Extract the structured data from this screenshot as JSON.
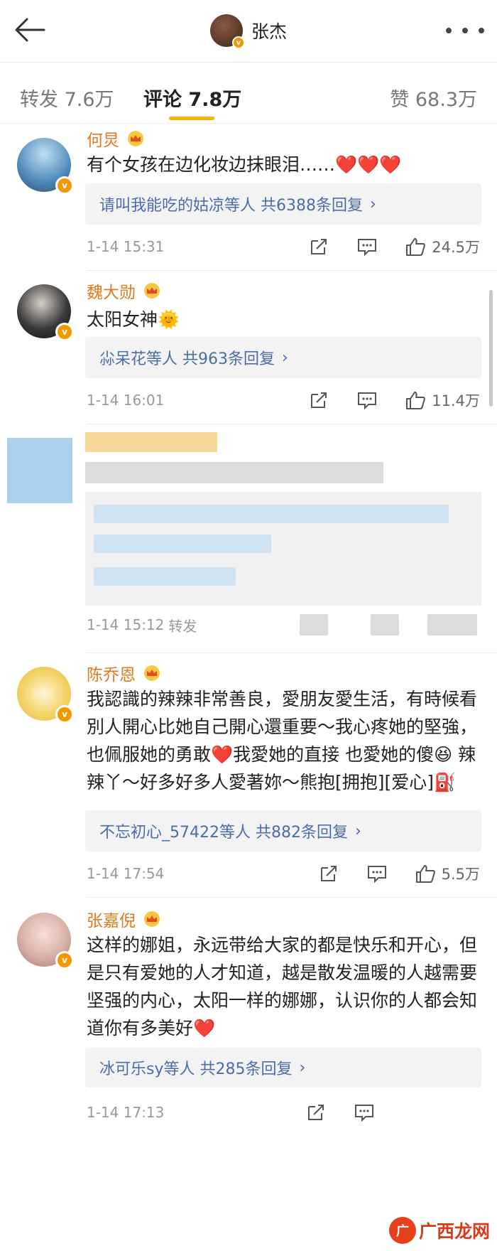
{
  "header": {
    "title": "张杰",
    "back_icon": "arrow-left-icon",
    "more_icon": "more-dots-icon"
  },
  "tabs": [
    {
      "label": "转发 7.6万"
    },
    {
      "label": "评论 7.8万"
    },
    {
      "label": "赞 68.3万"
    }
  ],
  "accent_color": "#f7b500",
  "name_color": "#e07a1f",
  "link_color": "#4a6ea8",
  "comments": [
    {
      "name": "何炅",
      "text": "有个女孩在边化妆边抹眼泪……❤️❤️❤️",
      "reply": "请叫我能吃的姑凉等人  共6388条回复",
      "time": "1-14 15:31",
      "likes": "24.5万"
    },
    {
      "name": "魏大勋",
      "text": "太阳女神🌞",
      "reply": "尛呆花等人  共963条回复",
      "time": "1-14 16:01",
      "likes": "11.4万"
    },
    {
      "name": "",
      "text": "",
      "reply": "",
      "time": "1-14 15:12",
      "extra": "转发",
      "likes": ""
    },
    {
      "name": "陈乔恩",
      "text": "我認識的辣辣非常善良，愛朋友愛生活，有時候看別人開心比她自己開心還重要～我心疼她的堅強，也佩服她的勇敢❤️我愛她的直接 也愛她的傻😆 辣辣丫～好多好多人愛著妳～熊抱[拥抱][爱心]⛽",
      "reply": "不忘初心_57422等人  共882条回复",
      "time": "1-14 17:54",
      "likes": "5.5万"
    },
    {
      "name": "张嘉倪",
      "text": "这样的娜姐，永远带给大家的都是快乐和开心，但是只有爱她的人才知道，越是散发温暖的人越需要坚强的内心，太阳一样的娜娜，认识你的人都会知道你有多美好❤️",
      "reply": "冰可乐sy等人  共285条回复",
      "time": "1-14 17:13",
      "likes": ""
    }
  ],
  "watermark": {
    "logo": "广",
    "text": "广西龙网"
  }
}
